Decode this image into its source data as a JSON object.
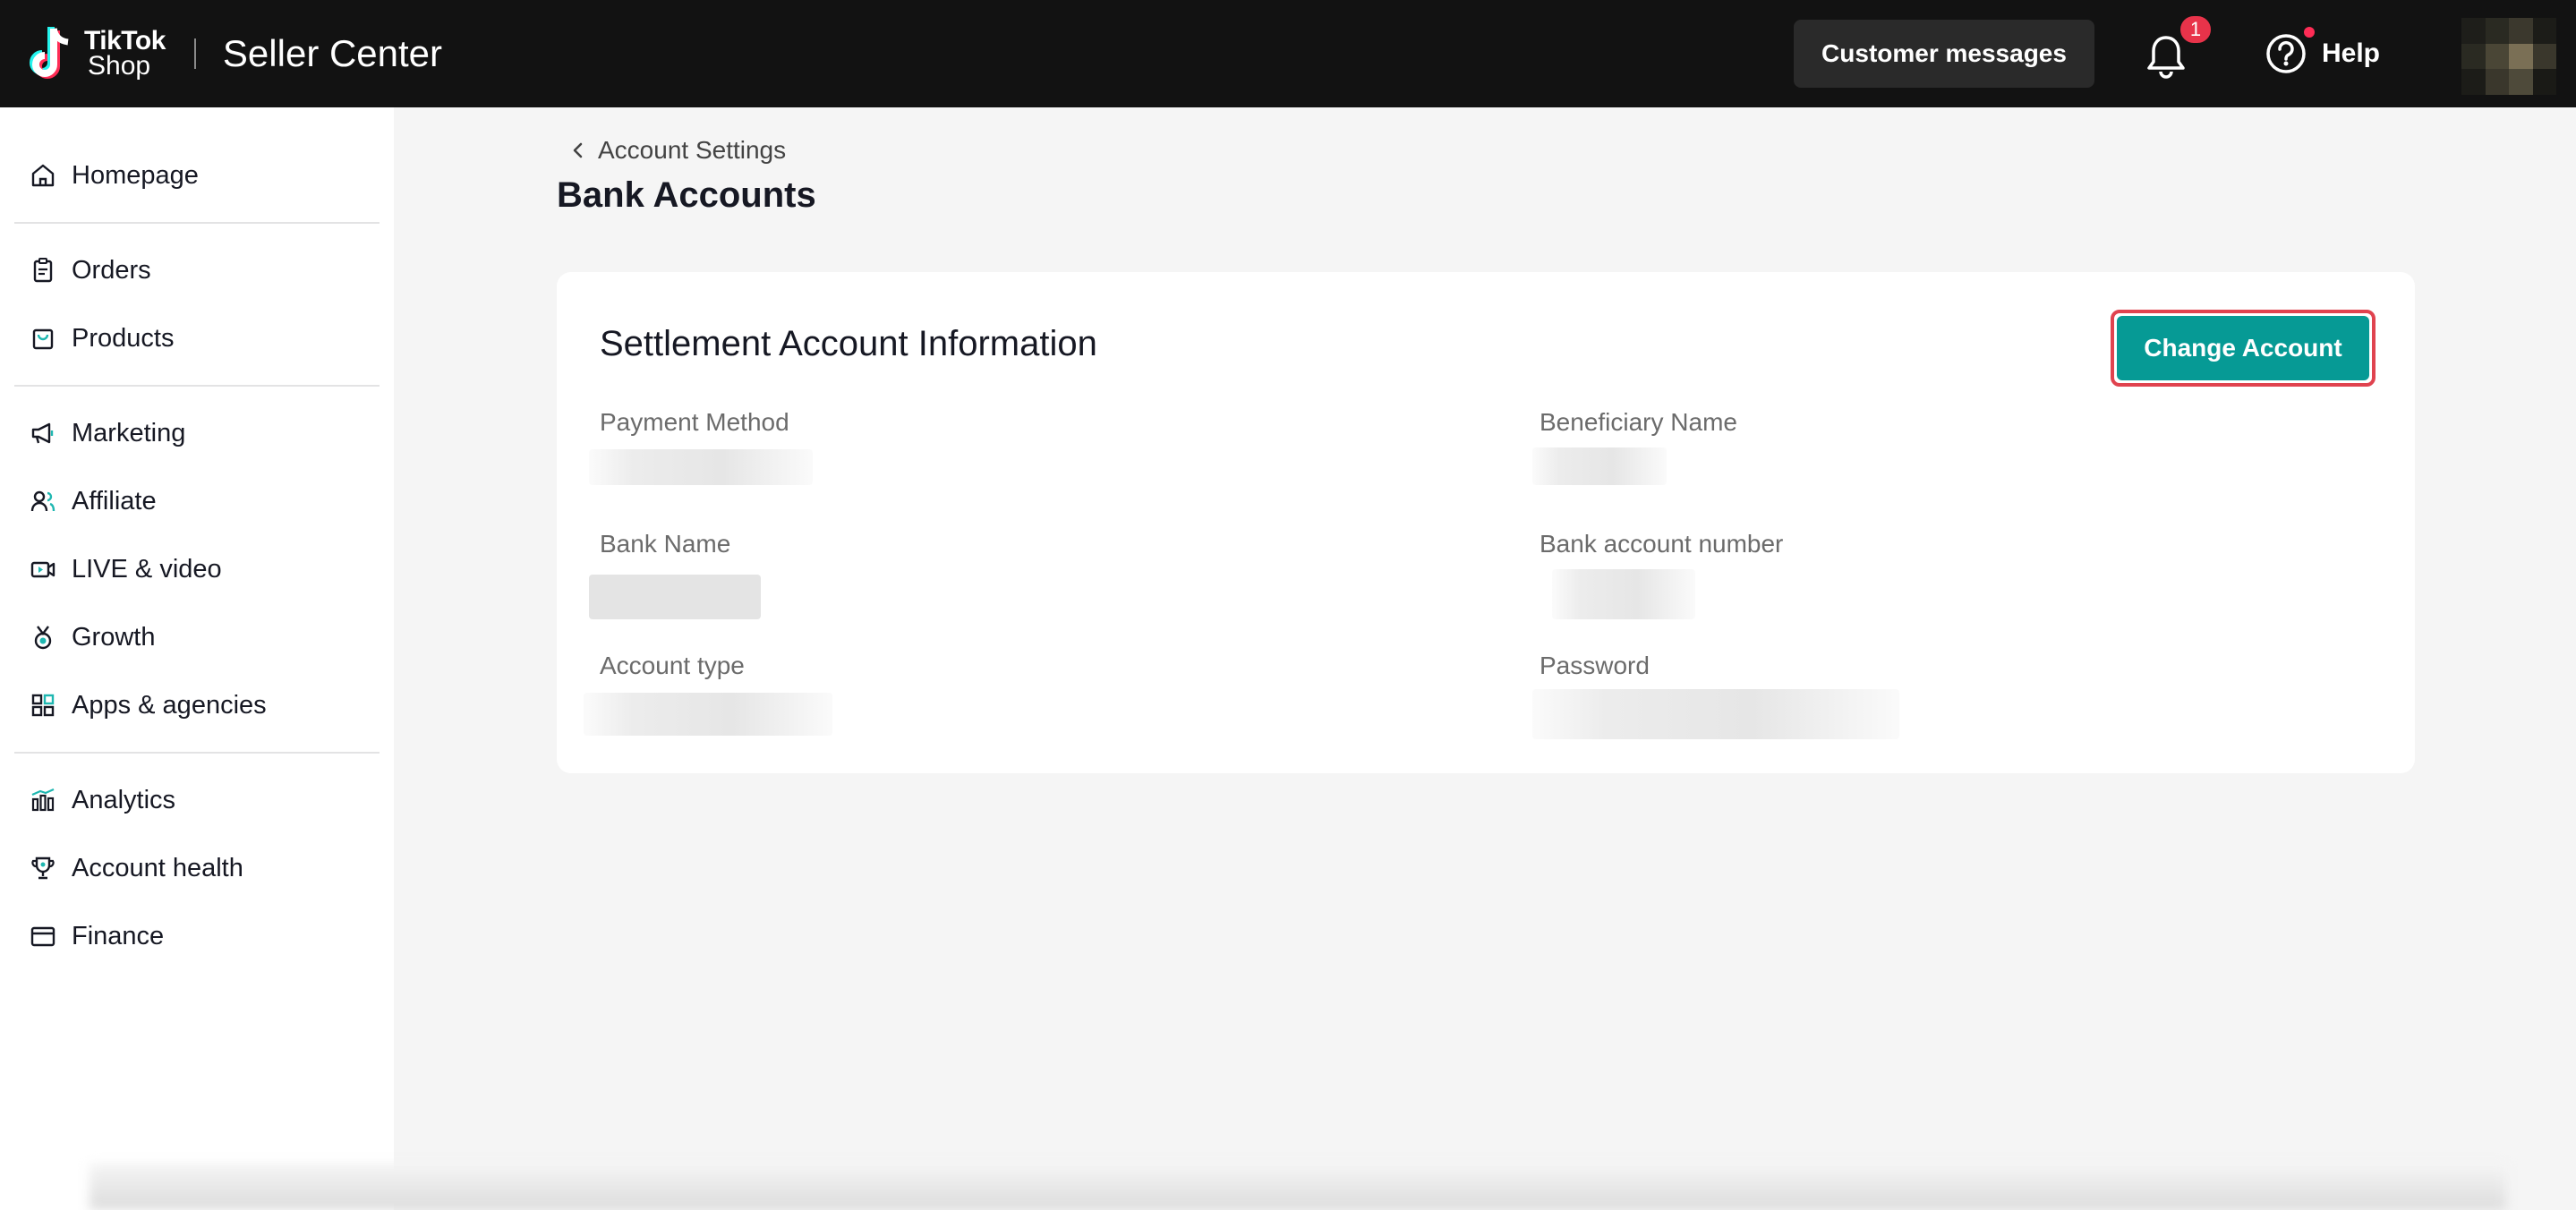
{
  "header": {
    "logo_line1": "TikTok",
    "logo_line2": "Shop",
    "title": "Seller Center",
    "customer_messages": "Customer messages",
    "notification_count": "1",
    "help": "Help"
  },
  "sidebar": {
    "items": [
      {
        "label": "Homepage",
        "icon": "home-icon"
      },
      {
        "label": "Orders",
        "icon": "clipboard-icon"
      },
      {
        "label": "Products",
        "icon": "bag-icon"
      },
      {
        "label": "Marketing",
        "icon": "megaphone-icon"
      },
      {
        "label": "Affiliate",
        "icon": "users-icon"
      },
      {
        "label": "LIVE & video",
        "icon": "video-icon"
      },
      {
        "label": "Growth",
        "icon": "medal-icon"
      },
      {
        "label": "Apps & agencies",
        "icon": "grid-icon"
      },
      {
        "label": "Analytics",
        "icon": "bar-chart-icon"
      },
      {
        "label": "Account health",
        "icon": "trophy-icon"
      },
      {
        "label": "Finance",
        "icon": "card-icon"
      }
    ]
  },
  "breadcrumb": {
    "back_label": "Account Settings"
  },
  "page": {
    "title": "Bank Accounts"
  },
  "card": {
    "title": "Settlement Account Information",
    "change_button": "Change Account",
    "fields": {
      "payment_method": "Payment Method",
      "beneficiary_name": "Beneficiary Name",
      "bank_name": "Bank Name",
      "bank_account_number": "Bank account number",
      "account_type": "Account type",
      "password": "Password"
    }
  },
  "colors": {
    "header_bg": "#121212",
    "accent": "#069a95",
    "highlight": "#e0434f",
    "badge": "#e8334a"
  }
}
